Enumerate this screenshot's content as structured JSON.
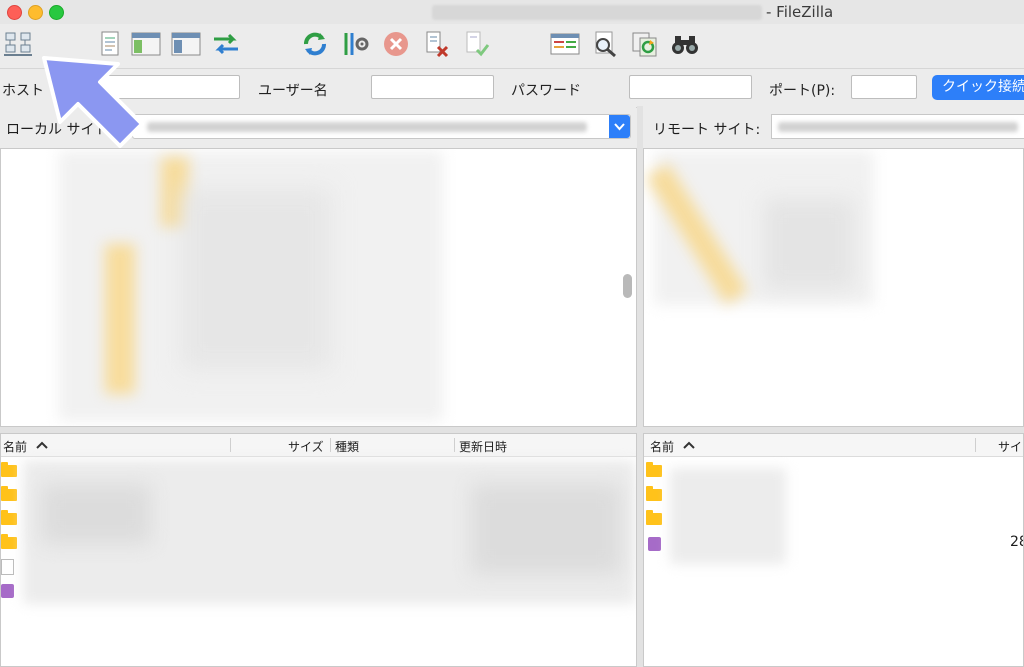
{
  "window": {
    "title": "- FileZilla"
  },
  "toolbar": {
    "icons": [
      "site-manager-icon",
      "log-icon",
      "directory-tree-icon",
      "remote-tree-icon",
      "transfer-queue-icon",
      "refresh-icon",
      "filter-icon",
      "cancel-icon",
      "disconnect-icon",
      "reconnect-icon",
      "compare-icon",
      "search-icon",
      "sync-browse-icon",
      "find-files-icon"
    ]
  },
  "quickconnect": {
    "host_label": "ホスト",
    "host_value": "",
    "user_label": "ユーザー名",
    "user_value": "",
    "pass_label": "パスワード",
    "pass_value": "",
    "port_label": "ポート(P):",
    "port_value": "",
    "connect_label": "クイック接続"
  },
  "local": {
    "site_label": "ローカル サイト:",
    "columns": {
      "name": "名前",
      "size": "サイズ",
      "type": "種類",
      "modified": "更新日時"
    }
  },
  "remote": {
    "site_label": "リモート サイト:",
    "columns": {
      "name": "名前",
      "size": "サイ"
    },
    "visible_size_value": "28"
  },
  "colors": {
    "accent": "#2d7ff9",
    "arrow": "#8a96f2",
    "folder": "#ffc21a"
  }
}
